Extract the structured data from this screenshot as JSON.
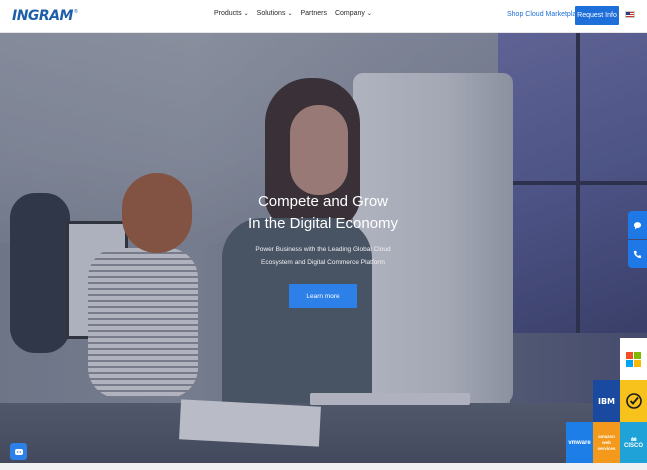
{
  "header": {
    "logo_text": "INGRAM",
    "nav": [
      {
        "label": "Products",
        "has_dropdown": true
      },
      {
        "label": "Solutions",
        "has_dropdown": true
      },
      {
        "label": "Partners",
        "has_dropdown": false
      },
      {
        "label": "Company",
        "has_dropdown": true
      }
    ],
    "shop_label": "Shop Cloud Marketplace",
    "request_label": "Request Info",
    "flag_icon": "us-flag-icon"
  },
  "hero": {
    "title_line1": "Compete and Grow",
    "title_line2": "In the Digital Economy",
    "subtitle_line1": "Power Business with the Leading Global Cloud",
    "subtitle_line2": "Ecosystem and Digital Commerce Platform",
    "cta_label": "Learn more"
  },
  "side_buttons": {
    "chat_icon": "chat-bubble-icon",
    "phone_icon": "phone-icon"
  },
  "partner_tiles": {
    "ibm": "IBM",
    "vmware": "vmware",
    "aws": "amazon web services",
    "cisco": "CISCO"
  },
  "colors": {
    "brand_blue": "#1e6fd9",
    "cta_blue": "#2d80e8"
  }
}
